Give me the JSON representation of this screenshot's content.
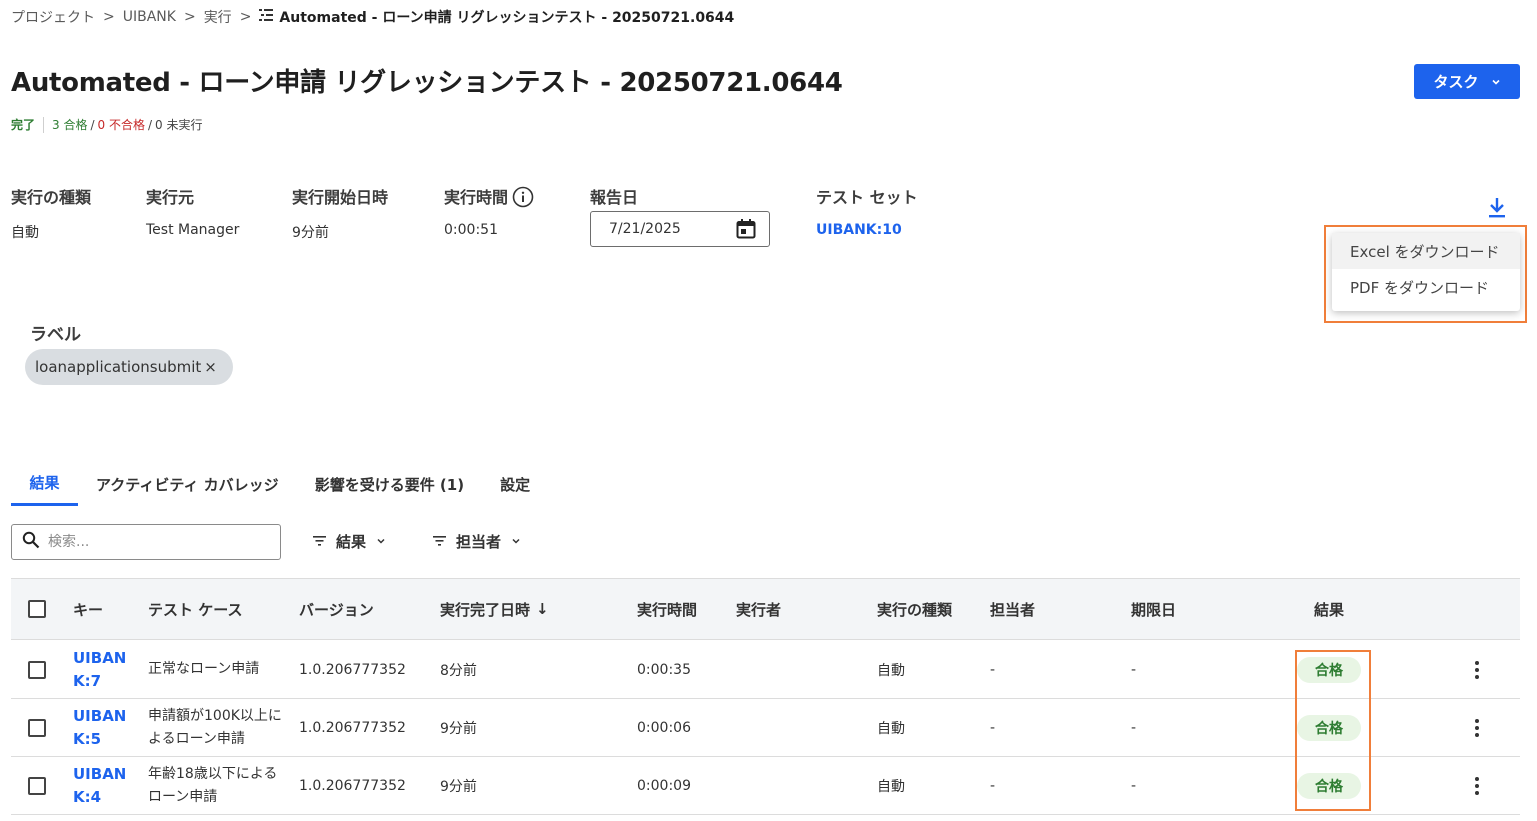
{
  "breadcrumb": {
    "items": [
      "プロジェクト",
      "UIBANK",
      "実行"
    ],
    "separator": ">",
    "current": "Automated - ローン申請 リグレッションテスト - 20250721.0644"
  },
  "title": "Automated - ローン申請 リグレッションテスト - 20250721.0644",
  "task_button": {
    "label": "タスク"
  },
  "status": {
    "complete": "完了",
    "passed": "3 合格",
    "failed": "0 不合格",
    "not_run": "0 未実行",
    "slash": "/"
  },
  "details": {
    "execution_type": {
      "label": "実行の種類",
      "value": "自動"
    },
    "executed_by": {
      "label": "実行元",
      "value": "Test Manager"
    },
    "start_time": {
      "label": "実行開始日時",
      "value": "9分前"
    },
    "duration": {
      "label": "実行時間",
      "value": "0:00:51"
    },
    "report_date": {
      "label": "報告日",
      "value": "7/21/2025"
    },
    "test_set": {
      "label": "テスト セット",
      "value": "UIBANK:10"
    }
  },
  "download_menu": {
    "items": [
      "Excel をダウンロード",
      "PDF をダウンロード"
    ]
  },
  "labels": {
    "heading": "ラベル",
    "chips": [
      "loanapplicationsubmit"
    ],
    "remove_glyph": "×"
  },
  "tabs": [
    {
      "label": "結果",
      "active": true
    },
    {
      "label": "アクティビティ カバレッジ",
      "active": false
    },
    {
      "label": "影響を受ける要件 (1)",
      "active": false
    },
    {
      "label": "設定",
      "active": false
    }
  ],
  "search": {
    "placeholder": "検索...",
    "value": ""
  },
  "filters": [
    {
      "label": "結果"
    },
    {
      "label": "担当者"
    }
  ],
  "table": {
    "columns": [
      "キー",
      "テスト ケース",
      "バージョン",
      "実行完了日時",
      "実行時間",
      "実行者",
      "実行の種類",
      "担当者",
      "期限日",
      "結果"
    ],
    "sort_indicator": "↓",
    "rows": [
      {
        "key": "UIBANK:7",
        "test_case": "正常なローン申請",
        "version": "1.0.206777352",
        "completed": "8分前",
        "duration": "0:00:35",
        "executor": "",
        "type": "自動",
        "assignee": "-",
        "due": "-",
        "result": "合格"
      },
      {
        "key": "UIBANK:5",
        "test_case": "申請額が100K以上によるローン申請",
        "version": "1.0.206777352",
        "completed": "9分前",
        "duration": "0:00:06",
        "executor": "",
        "type": "自動",
        "assignee": "-",
        "due": "-",
        "result": "合格"
      },
      {
        "key": "UIBANK:4",
        "test_case": "年齢18歳以下によるローン申請",
        "version": "1.0.206777352",
        "completed": "9分前",
        "duration": "0:00:09",
        "executor": "",
        "type": "自動",
        "assignee": "-",
        "due": "-",
        "result": "合格"
      }
    ]
  },
  "colors": {
    "accent": "#1d63ed",
    "pass": "#2e7d32",
    "fail": "#c62828",
    "highlight": "#f07e3a",
    "pass_badge_bg": "#e8f5e4"
  },
  "icons": [
    "list-icon",
    "chevron-down-icon",
    "info-icon",
    "calendar-icon",
    "download-icon",
    "close-icon",
    "search-icon",
    "filter-icon",
    "sort-arrow-icon",
    "kebab-menu-icon"
  ]
}
